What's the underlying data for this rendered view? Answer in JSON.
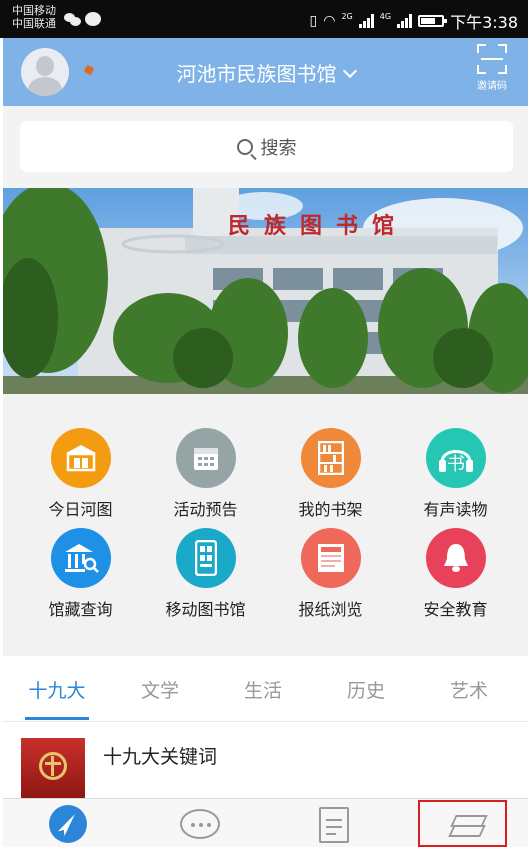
{
  "status_bar": {
    "carrier_1": "中国移动",
    "carrier_2": "中国联通",
    "net_1": "2G",
    "net_2": "4G",
    "time": "下午3:38",
    "battery_level": 0.7
  },
  "header": {
    "library_name": "河池市民族图书馆",
    "invite_label": "邀请码"
  },
  "search": {
    "label": "搜索"
  },
  "banner": {
    "sign_text": "民族图书馆"
  },
  "features": [
    {
      "label": "今日河图",
      "icon": "library-icon",
      "color": "#f39c12"
    },
    {
      "label": "活动预告",
      "icon": "calendar-icon",
      "color": "#95a5a6"
    },
    {
      "label": "我的书架",
      "icon": "bookshelf-icon",
      "color": "#f0883a"
    },
    {
      "label": "有声读物",
      "icon": "audiobook-icon",
      "color": "#25c6b4"
    },
    {
      "label": "馆藏查询",
      "icon": "collection-search-icon",
      "color": "#1e90e6"
    },
    {
      "label": "移动图书馆",
      "icon": "mobile-library-icon",
      "color": "#1aa9c9"
    },
    {
      "label": "报纸浏览",
      "icon": "newspaper-icon",
      "color": "#f0685a"
    },
    {
      "label": "安全教育",
      "icon": "bell-icon",
      "color": "#e8425a"
    }
  ],
  "tabs": [
    "十九大",
    "文学",
    "生活",
    "历史",
    "艺术"
  ],
  "active_tab": 0,
  "list": [
    {
      "title": "十九大关键词"
    }
  ],
  "colors": {
    "header_bg": "#7fb3e8",
    "accent": "#2b86d9",
    "highlight": "#d62020"
  }
}
